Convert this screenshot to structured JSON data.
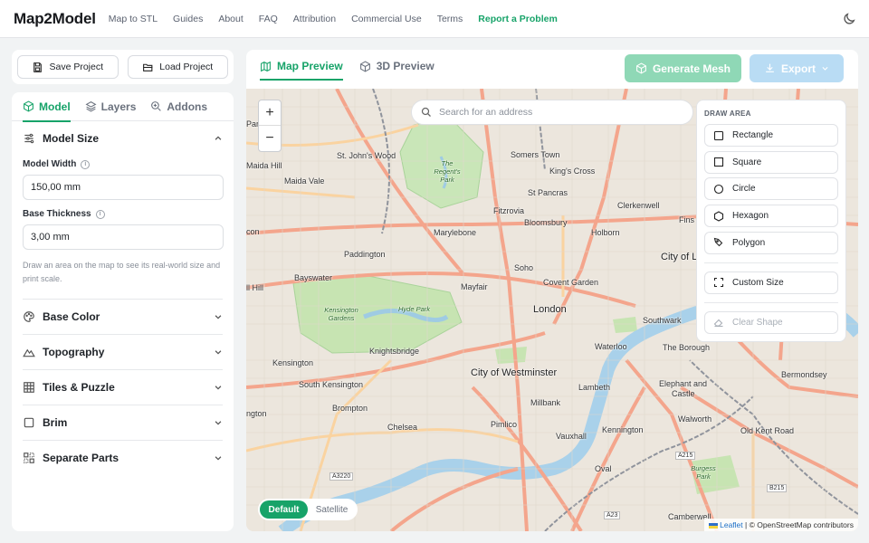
{
  "app": {
    "logo": "Map2Model"
  },
  "nav": {
    "links": [
      "Map to STL",
      "Guides",
      "About",
      "FAQ",
      "Attribution",
      "Commercial Use",
      "Terms"
    ],
    "report": "Report a Problem"
  },
  "project": {
    "save": "Save Project",
    "load": "Load Project"
  },
  "sidebar": {
    "tabs": [
      "Model",
      "Layers",
      "Addons"
    ],
    "model_size": {
      "title": "Model Size",
      "width_label": "Model Width",
      "width_value": "150,00 mm",
      "thickness_label": "Base Thickness",
      "thickness_value": "3,00 mm",
      "hint": "Draw an area on the map to see its real-world size and print scale."
    },
    "sections": [
      "Base Color",
      "Topography",
      "Tiles & Puzzle",
      "Brim",
      "Separate Parts"
    ]
  },
  "main": {
    "tabs": [
      "Map Preview",
      "3D Preview"
    ],
    "generate": "Generate Mesh",
    "export": "Export"
  },
  "map": {
    "search_placeholder": "Search for an address",
    "draw_title": "DRAW AREA",
    "shapes": [
      "Rectangle",
      "Square",
      "Circle",
      "Hexagon",
      "Polygon"
    ],
    "custom_size": "Custom Size",
    "clear_shape": "Clear Shape",
    "layers": [
      "Default",
      "Satellite"
    ],
    "attribution_leaflet": "Leaflet",
    "attribution_rest": "| © OpenStreetMap contributors",
    "labels": {
      "st_johns_wood": "St. John's Wood",
      "somers_town": "Somers Town",
      "kings_cross": "King's Cross",
      "regents_park": "The Regent's Park",
      "maida_hill": "Maida Hill",
      "maida_vale": "Maida Vale",
      "st_pancras": "St Pancras",
      "clerkenwell": "Clerkenwell",
      "fitzrovia": "Fitzrovia",
      "bloomsbury": "Bloomsbury",
      "marylebone": "Marylebone",
      "holborn": "Holborn",
      "fins": "Fins",
      "paddington": "Paddington",
      "city_of": "City of L",
      "bayswater": "Bayswater",
      "soho": "Soho",
      "mayfair": "Mayfair",
      "covent_garden": "Covent Garden",
      "london": "London",
      "southwark": "Southwark",
      "kensington_gardens": "Kensington Gardens",
      "hyde_park": "Hyde Park",
      "knightsbridge": "Knightsbridge",
      "waterloo": "Waterloo",
      "the_borough": "The Borough",
      "kensington": "Kensington",
      "city_of_westminster": "City of Westminster",
      "bermondsey": "Bermondsey",
      "south_kensington": "South Kensington",
      "lambeth": "Lambeth",
      "elephant_and": "Elephant and",
      "castle": "Castle",
      "brompton": "Brompton",
      "millbank": "Millbank",
      "chelsea": "Chelsea",
      "pimlico": "Pimlico",
      "kennington": "Kennington",
      "walworth": "Walworth",
      "vauxhall": "Vauxhall",
      "old_kent_road": "Old Kent Road",
      "oval": "Oval",
      "burgess_park": "Burgess Park",
      "camberwell": "Camberwell",
      "ngton": "ngton",
      "ll_hill": "ll Hill",
      "con": "con",
      "park": "Park",
      "a3220": "A3220",
      "a215": "A215",
      "b215": "B215",
      "a23": "A23"
    }
  },
  "colors": {
    "accent": "#17a369",
    "generate_bg": "#8fd8b6",
    "export_bg": "#b9dcf4"
  }
}
